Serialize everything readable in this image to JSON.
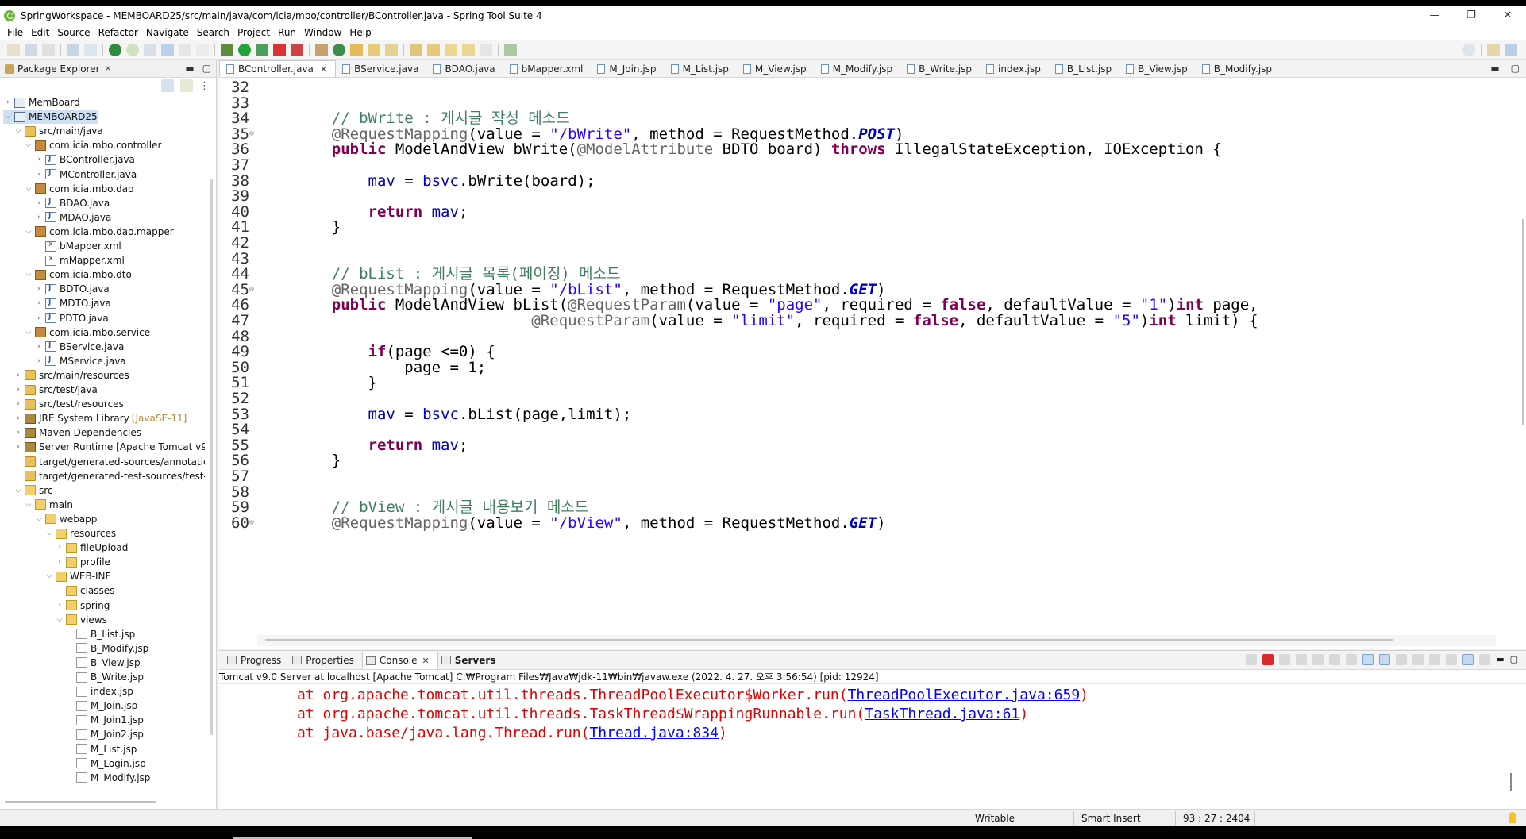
{
  "window": {
    "title": "SpringWorkspace - MEMBOARD25/src/main/java/com/icia/mbo/controller/BController.java - Spring Tool Suite 4",
    "controls": [
      "—",
      "❐",
      "✕"
    ]
  },
  "menu": [
    "File",
    "Edit",
    "Source",
    "Refactor",
    "Navigate",
    "Search",
    "Project",
    "Run",
    "Window",
    "Help"
  ],
  "explorer": {
    "title": "Package Explorer",
    "items": [
      {
        "label": "MemBoard",
        "depth": 0,
        "twisty": "›",
        "icon": "project"
      },
      {
        "label": "MEMBOARD25",
        "depth": 0,
        "twisty": "⌄",
        "icon": "project",
        "selected": true
      },
      {
        "label": "src/main/java",
        "depth": 1,
        "twisty": "⌄",
        "icon": "srcfolder"
      },
      {
        "label": "com.icia.mbo.controller",
        "depth": 2,
        "twisty": "⌄",
        "icon": "package"
      },
      {
        "label": "BController.java",
        "depth": 3,
        "twisty": "›",
        "icon": "java"
      },
      {
        "label": "MController.java",
        "depth": 3,
        "twisty": "›",
        "icon": "java"
      },
      {
        "label": "com.icia.mbo.dao",
        "depth": 2,
        "twisty": "⌄",
        "icon": "package"
      },
      {
        "label": "BDAO.java",
        "depth": 3,
        "twisty": "›",
        "icon": "java"
      },
      {
        "label": "MDAO.java",
        "depth": 3,
        "twisty": "›",
        "icon": "java"
      },
      {
        "label": "com.icia.mbo.dao.mapper",
        "depth": 2,
        "twisty": "⌄",
        "icon": "package"
      },
      {
        "label": "bMapper.xml",
        "depth": 3,
        "twisty": "",
        "icon": "xml"
      },
      {
        "label": "mMapper.xml",
        "depth": 3,
        "twisty": "",
        "icon": "xml"
      },
      {
        "label": "com.icia.mbo.dto",
        "depth": 2,
        "twisty": "⌄",
        "icon": "package"
      },
      {
        "label": "BDTO.java",
        "depth": 3,
        "twisty": "›",
        "icon": "java"
      },
      {
        "label": "MDTO.java",
        "depth": 3,
        "twisty": "›",
        "icon": "java"
      },
      {
        "label": "PDTO.java",
        "depth": 3,
        "twisty": "›",
        "icon": "java"
      },
      {
        "label": "com.icia.mbo.service",
        "depth": 2,
        "twisty": "⌄",
        "icon": "package"
      },
      {
        "label": "BService.java",
        "depth": 3,
        "twisty": "›",
        "icon": "java"
      },
      {
        "label": "MService.java",
        "depth": 3,
        "twisty": "›",
        "icon": "java"
      },
      {
        "label": "src/main/resources",
        "depth": 1,
        "twisty": "›",
        "icon": "srcfolder"
      },
      {
        "label": "src/test/java",
        "depth": 1,
        "twisty": "›",
        "icon": "srcfolder"
      },
      {
        "label": "src/test/resources",
        "depth": 1,
        "twisty": "›",
        "icon": "srcfolder"
      },
      {
        "label": "JRE System Library",
        "decor": "[JavaSE-11]",
        "depth": 1,
        "twisty": "›",
        "icon": "lib"
      },
      {
        "label": "Maven Dependencies",
        "depth": 1,
        "twisty": "›",
        "icon": "lib"
      },
      {
        "label": "Server Runtime [Apache Tomcat v9.",
        "depth": 1,
        "twisty": "›",
        "icon": "lib"
      },
      {
        "label": "target/generated-sources/annotatior",
        "depth": 1,
        "twisty": "",
        "icon": "srcfolder"
      },
      {
        "label": "target/generated-test-sources/test-ar",
        "depth": 1,
        "twisty": "",
        "icon": "srcfolder"
      },
      {
        "label": "src",
        "depth": 1,
        "twisty": "⌄",
        "icon": "folder"
      },
      {
        "label": "main",
        "depth": 2,
        "twisty": "⌄",
        "icon": "folder"
      },
      {
        "label": "webapp",
        "depth": 3,
        "twisty": "⌄",
        "icon": "folder"
      },
      {
        "label": "resources",
        "depth": 4,
        "twisty": "⌄",
        "icon": "folder"
      },
      {
        "label": "fileUpload",
        "depth": 5,
        "twisty": "›",
        "icon": "folder"
      },
      {
        "label": "profile",
        "depth": 5,
        "twisty": "›",
        "icon": "folder"
      },
      {
        "label": "WEB-INF",
        "depth": 4,
        "twisty": "⌄",
        "icon": "folder"
      },
      {
        "label": "classes",
        "depth": 5,
        "twisty": "",
        "icon": "folder"
      },
      {
        "label": "spring",
        "depth": 5,
        "twisty": "›",
        "icon": "folder"
      },
      {
        "label": "views",
        "depth": 5,
        "twisty": "⌄",
        "icon": "folder"
      },
      {
        "label": "B_List.jsp",
        "depth": 6,
        "twisty": "",
        "icon": "jsp"
      },
      {
        "label": "B_Modify.jsp",
        "depth": 6,
        "twisty": "",
        "icon": "jsp"
      },
      {
        "label": "B_View.jsp",
        "depth": 6,
        "twisty": "",
        "icon": "jsp"
      },
      {
        "label": "B_Write.jsp",
        "depth": 6,
        "twisty": "",
        "icon": "jsp"
      },
      {
        "label": "index.jsp",
        "depth": 6,
        "twisty": "",
        "icon": "jsp"
      },
      {
        "label": "M_Join.jsp",
        "depth": 6,
        "twisty": "",
        "icon": "jsp"
      },
      {
        "label": "M_Join1.jsp",
        "depth": 6,
        "twisty": "",
        "icon": "jsp"
      },
      {
        "label": "M_Join2.jsp",
        "depth": 6,
        "twisty": "",
        "icon": "jsp"
      },
      {
        "label": "M_List.jsp",
        "depth": 6,
        "twisty": "",
        "icon": "jsp"
      },
      {
        "label": "M_Login.jsp",
        "depth": 6,
        "twisty": "",
        "icon": "jsp"
      },
      {
        "label": "M_Modify.jsp",
        "depth": 6,
        "twisty": "",
        "icon": "jsp"
      }
    ]
  },
  "editor": {
    "tabs": [
      {
        "label": "BController.java",
        "active": true,
        "icon": "java-file-icon"
      },
      {
        "label": "BService.java",
        "icon": "java-file-icon"
      },
      {
        "label": "BDAO.java",
        "icon": "java-file-icon"
      },
      {
        "label": "bMapper.xml",
        "icon": "xml-file-icon"
      },
      {
        "label": "M_Join.jsp",
        "icon": "jsp-file-icon"
      },
      {
        "label": "M_List.jsp",
        "icon": "jsp-file-icon"
      },
      {
        "label": "M_View.jsp",
        "icon": "jsp-file-icon"
      },
      {
        "label": "M_Modify.jsp",
        "icon": "jsp-file-icon"
      },
      {
        "label": "B_Write.jsp",
        "icon": "jsp-file-icon"
      },
      {
        "label": "index.jsp",
        "icon": "jsp-file-icon"
      },
      {
        "label": "B_List.jsp",
        "icon": "jsp-file-icon"
      },
      {
        "label": "B_View.jsp",
        "icon": "jsp-file-icon"
      },
      {
        "label": "B_Modify.jsp",
        "icon": "jsp-file-icon"
      }
    ],
    "lines": [
      {
        "n": "32",
        "segs": []
      },
      {
        "n": "33",
        "segs": []
      },
      {
        "n": "34",
        "segs": [
          [
            "cm",
            "    // bWrite : 게시글 작성 메소드"
          ]
        ]
      },
      {
        "n": "35",
        "fold": "⊖",
        "segs": [
          [
            "ann",
            "    @RequestMapping"
          ],
          [
            "",
            "(value = "
          ],
          [
            "str",
            "\"/bWrite\""
          ],
          [
            "",
            ", method = RequestMethod."
          ],
          [
            "ital",
            "POST"
          ],
          [
            "",
            ")"
          ]
        ]
      },
      {
        "n": "36",
        "segs": [
          [
            "kw",
            "    public"
          ],
          [
            "",
            " ModelAndView bWrite("
          ],
          [
            "ann",
            "@ModelAttribute"
          ],
          [
            "",
            " BDTO board) "
          ],
          [
            "kw",
            "throws"
          ],
          [
            "",
            " IllegalStateException, IOException {"
          ]
        ]
      },
      {
        "n": "37",
        "segs": []
      },
      {
        "n": "38",
        "segs": [
          [
            "",
            "        "
          ],
          [
            "fld",
            "mav"
          ],
          [
            "",
            " = "
          ],
          [
            "fld",
            "bsvc"
          ],
          [
            "",
            ".bWrite(board);"
          ]
        ]
      },
      {
        "n": "39",
        "segs": []
      },
      {
        "n": "40",
        "segs": [
          [
            "kw",
            "        return"
          ],
          [
            "",
            " "
          ],
          [
            "fld",
            "mav"
          ],
          [
            "",
            ";"
          ]
        ]
      },
      {
        "n": "41",
        "segs": [
          [
            "",
            "    }"
          ]
        ]
      },
      {
        "n": "42",
        "segs": []
      },
      {
        "n": "43",
        "segs": []
      },
      {
        "n": "44",
        "segs": [
          [
            "cm",
            "    // bList : 게시글 목록(페이징) 메소드"
          ]
        ]
      },
      {
        "n": "45",
        "fold": "⊖",
        "segs": [
          [
            "ann",
            "    @RequestMapping"
          ],
          [
            "",
            "(value = "
          ],
          [
            "str",
            "\"/bList\""
          ],
          [
            "",
            ", method = RequestMethod."
          ],
          [
            "ital",
            "GET"
          ],
          [
            "",
            ")"
          ]
        ]
      },
      {
        "n": "46",
        "segs": [
          [
            "kw",
            "    public"
          ],
          [
            "",
            " ModelAndView bList("
          ],
          [
            "ann",
            "@RequestParam"
          ],
          [
            "",
            "(value = "
          ],
          [
            "str",
            "\"page\""
          ],
          [
            "",
            ", required = "
          ],
          [
            "kw",
            "false"
          ],
          [
            "",
            ", defaultValue = "
          ],
          [
            "str",
            "\"1\""
          ],
          [
            "",
            ")"
          ],
          [
            "kw",
            "int"
          ],
          [
            "",
            " page,"
          ]
        ]
      },
      {
        "n": "47",
        "segs": [
          [
            "",
            "                          "
          ],
          [
            "ann",
            "@RequestParam"
          ],
          [
            "",
            "(value = "
          ],
          [
            "str",
            "\"limit\""
          ],
          [
            "",
            ", required = "
          ],
          [
            "kw",
            "false"
          ],
          [
            "",
            ", defaultValue = "
          ],
          [
            "str",
            "\"5\""
          ],
          [
            "",
            ")"
          ],
          [
            "kw",
            "int"
          ],
          [
            "",
            " limit) {"
          ]
        ]
      },
      {
        "n": "48",
        "segs": []
      },
      {
        "n": "49",
        "segs": [
          [
            "kw",
            "        if"
          ],
          [
            "",
            "(page <=0) {"
          ]
        ]
      },
      {
        "n": "50",
        "segs": [
          [
            "",
            "            page = 1;"
          ]
        ]
      },
      {
        "n": "51",
        "segs": [
          [
            "",
            "        }"
          ]
        ]
      },
      {
        "n": "52",
        "segs": []
      },
      {
        "n": "53",
        "segs": [
          [
            "",
            "        "
          ],
          [
            "fld",
            "mav"
          ],
          [
            "",
            " = "
          ],
          [
            "fld",
            "bsvc"
          ],
          [
            "",
            ".bList(page,limit);"
          ]
        ]
      },
      {
        "n": "54",
        "segs": []
      },
      {
        "n": "55",
        "segs": [
          [
            "kw",
            "        return"
          ],
          [
            "",
            " "
          ],
          [
            "fld",
            "mav"
          ],
          [
            "",
            ";"
          ]
        ]
      },
      {
        "n": "56",
        "segs": [
          [
            "",
            "    }"
          ]
        ]
      },
      {
        "n": "57",
        "segs": []
      },
      {
        "n": "58",
        "segs": []
      },
      {
        "n": "59",
        "segs": [
          [
            "cm",
            "    // bView : 게시글 내용보기 메소드"
          ]
        ]
      },
      {
        "n": "60",
        "fold": "⊖",
        "segs": [
          [
            "ann",
            "    @RequestMapping"
          ],
          [
            "",
            "(value = "
          ],
          [
            "str",
            "\"/bView\""
          ],
          [
            "",
            ", method = RequestMethod."
          ],
          [
            "ital",
            "GET"
          ],
          [
            "",
            ")"
          ]
        ]
      }
    ]
  },
  "bottom": {
    "tabs": [
      {
        "label": "Progress"
      },
      {
        "label": "Properties"
      },
      {
        "label": "Console",
        "active": true,
        "closable": true
      },
      {
        "label": "Servers",
        "bold": true
      }
    ],
    "console_header": "Tomcat v9.0 Server at localhost [Apache Tomcat] C:₩Program Files₩Java₩jdk-11₩bin₩javaw.exe  (2022. 4. 27. 오후 3:56:54) [pid: 12924]",
    "lines": [
      {
        "pre": "at org.apache.tomcat.util.threads.ThreadPoolExecutor$Worker.run(",
        "link": "ThreadPoolExecutor.java:659",
        "post": ")"
      },
      {
        "pre": "at org.apache.tomcat.util.threads.TaskThread$WrappingRunnable.run(",
        "link": "TaskThread.java:61",
        "post": ")"
      },
      {
        "pre": "at java.base/java.lang.Thread.run(",
        "link": "Thread.java:834",
        "post": ")"
      }
    ]
  },
  "status": {
    "mode": "Writable",
    "insert": "Smart Insert",
    "position": "93 : 27 : 2404"
  }
}
